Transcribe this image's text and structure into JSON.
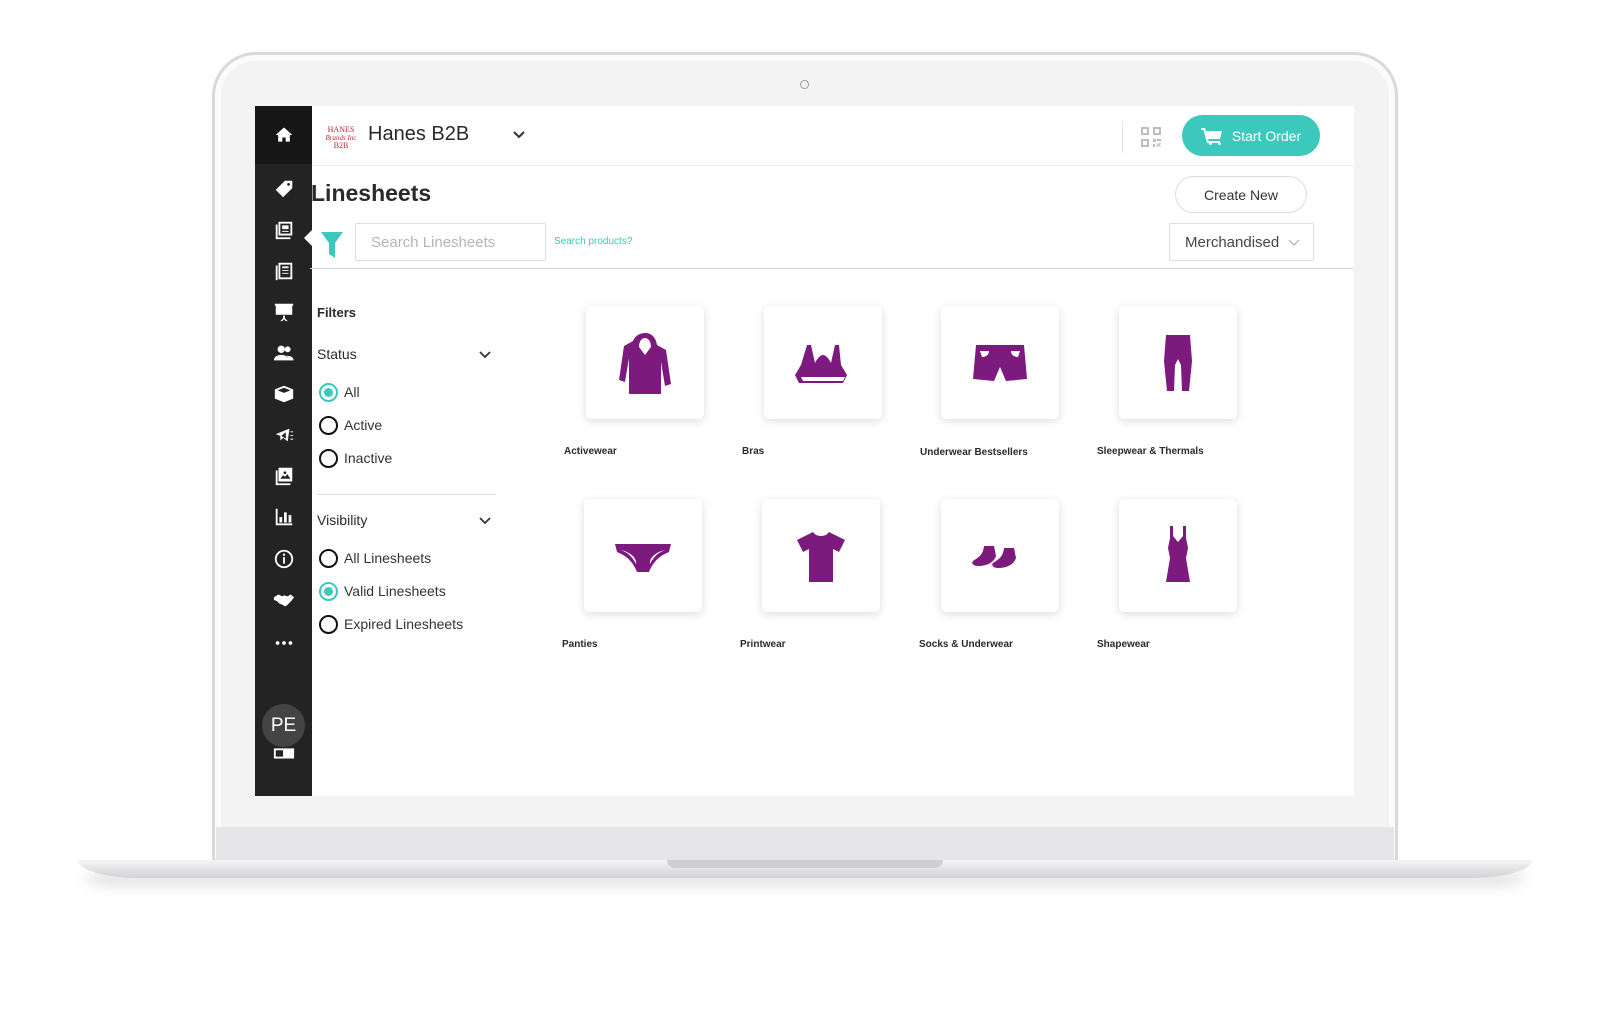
{
  "app": {
    "brand": {
      "logo_lines": [
        "HANES",
        "Brands Inc",
        "B2B"
      ],
      "name": "Hanes B2B"
    },
    "start_order_label": "Start Order"
  },
  "sidebar": {
    "items": [
      {
        "icon": "home-icon"
      },
      {
        "icon": "tag-icon"
      },
      {
        "icon": "linesheets-icon"
      },
      {
        "icon": "catalog-icon"
      },
      {
        "icon": "presentation-icon"
      },
      {
        "icon": "customers-icon"
      },
      {
        "icon": "package-icon"
      },
      {
        "icon": "campaign-icon"
      },
      {
        "icon": "images-icon"
      },
      {
        "icon": "reports-icon"
      },
      {
        "icon": "info-icon"
      },
      {
        "icon": "handshake-icon"
      },
      {
        "icon": "more-icon"
      }
    ],
    "avatar_initials": "PE"
  },
  "page": {
    "title": "Linesheets",
    "create_new_label": "Create New",
    "search_placeholder": "Search Linesheets",
    "search_products_link": "Search products?",
    "sort_value": "Merchandised"
  },
  "filters": {
    "heading": "Filters",
    "status": {
      "title": "Status",
      "options": [
        {
          "label": "All",
          "checked": true
        },
        {
          "label": "Active",
          "checked": false
        },
        {
          "label": "Inactive",
          "checked": false
        }
      ]
    },
    "visibility": {
      "title": "Visibility",
      "options": [
        {
          "label": "All Linesheets",
          "checked": false
        },
        {
          "label": "Valid Linesheets",
          "checked": true
        },
        {
          "label": "Expired Linesheets",
          "checked": false
        }
      ]
    }
  },
  "linesheets": [
    {
      "label": "Activewear",
      "icon": "hoodie-icon"
    },
    {
      "label": "Bras",
      "icon": "sports-bra-icon"
    },
    {
      "label": "Underwear Bestsellers",
      "icon": "shorts-icon"
    },
    {
      "label": "Sleepwear & Thermals",
      "icon": "leggings-icon"
    },
    {
      "label": "Panties",
      "icon": "panties-icon"
    },
    {
      "label": "Printwear",
      "icon": "tshirt-icon"
    },
    {
      "label": "Socks & Underwear",
      "icon": "socks-icon"
    },
    {
      "label": "Shapewear",
      "icon": "shapewear-icon"
    }
  ],
  "colors": {
    "accent": "#3cc8bd",
    "sidebar": "#232323",
    "product_icon": "#7d1a7d"
  }
}
